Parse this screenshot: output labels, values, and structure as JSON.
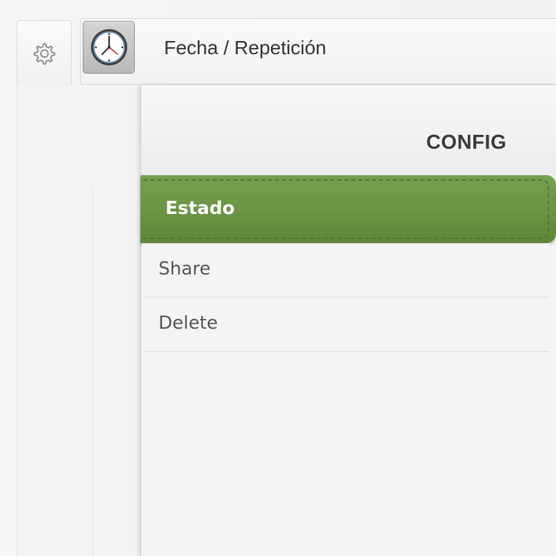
{
  "header": {
    "title": "Fecha / Repetición",
    "clock_icon": "clock-icon",
    "settings_icon": "gear-icon"
  },
  "config": {
    "title": "CONFIG",
    "accent_color": "#6a9344",
    "items": [
      {
        "label": "Estado",
        "active": true
      },
      {
        "label": "Share",
        "active": false
      },
      {
        "label": "Delete",
        "active": false
      }
    ]
  }
}
